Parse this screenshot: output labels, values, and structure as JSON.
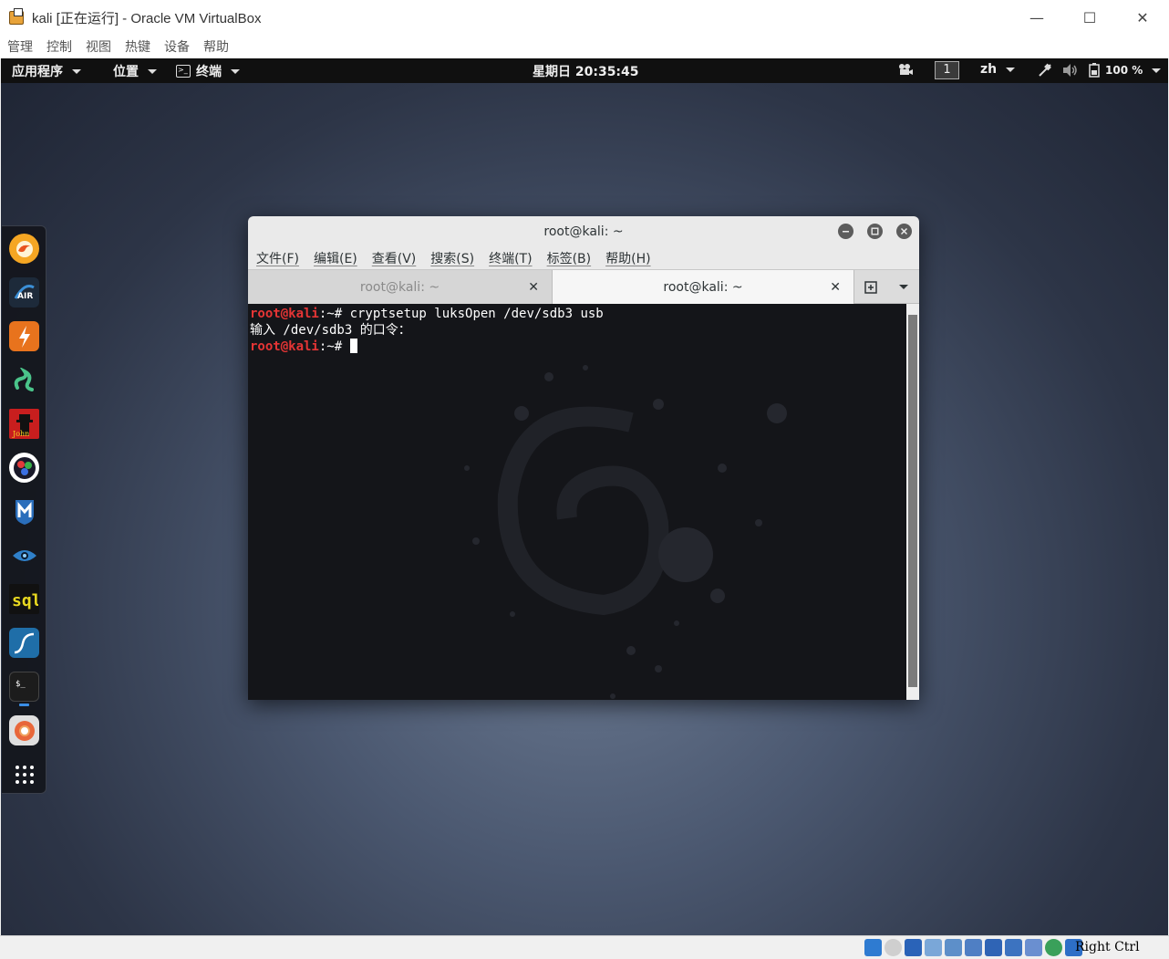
{
  "host": {
    "title": "kali [正在运行] - Oracle VM VirtualBox",
    "menu": [
      "管理",
      "控制",
      "视图",
      "热键",
      "设备",
      "帮助"
    ],
    "minimize": "—",
    "maximize": "☐",
    "close": "✕",
    "hostkey_label": "Right Ctrl"
  },
  "topbar": {
    "applications": "应用程序",
    "places": "位置",
    "terminal": "终端",
    "terminal_icon_glyph": ">_",
    "clock": "星期日 20:35:45",
    "workspace": "1",
    "language": "zh",
    "battery": "100 %"
  },
  "dock": {
    "apps": [
      "firefox-icon",
      "aircrack-icon",
      "burpsuite-icon",
      "python-snake-icon",
      "john-ripper-icon",
      "maltego-icon",
      "metasploit-icon",
      "eye-recon-icon",
      "sqlmap-icon",
      "wireshark-icon",
      "terminal-icon",
      "chromium-icon",
      "show-apps-icon"
    ]
  },
  "terminal": {
    "title": "root@kali: ~",
    "menu": [
      "文件(F)",
      "编辑(E)",
      "查看(V)",
      "搜索(S)",
      "终端(T)",
      "标签(B)",
      "帮助(H)"
    ],
    "tabs": [
      {
        "label": "root@kali: ~"
      },
      {
        "label": "root@kali: ~"
      }
    ],
    "lines": [
      {
        "user": "root@kali",
        "path": ":~# ",
        "cmd": "cryptsetup luksOpen /dev/sdb3 usb"
      },
      {
        "output": "输入 /dev/sdb3 的口令："
      },
      {
        "user": "root@kali",
        "path": ":~# ",
        "cmd": ""
      }
    ]
  },
  "colors": {
    "prompt_user": "#e53535",
    "terminal_bg": "#141519",
    "topbar_bg": "#101010"
  }
}
